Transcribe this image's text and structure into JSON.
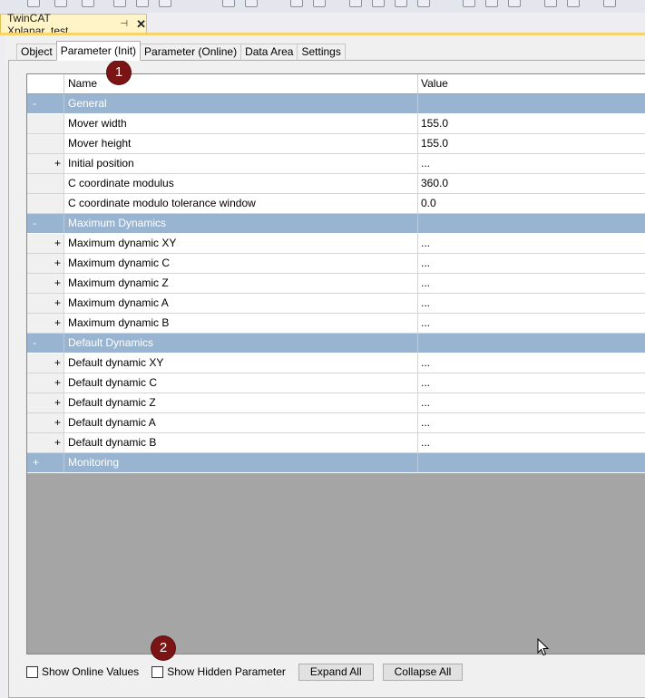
{
  "document_tab": {
    "title": "TwinCAT Xplanar_test",
    "pin_glyph": "⊣",
    "close_glyph": "✕"
  },
  "tabs": [
    {
      "label": "Object",
      "active": false
    },
    {
      "label": "Parameter (Init)",
      "active": true
    },
    {
      "label": "Parameter (Online)",
      "active": false
    },
    {
      "label": "Data Area",
      "active": false
    },
    {
      "label": "Settings",
      "active": false
    }
  ],
  "grid": {
    "columns": {
      "name": "Name",
      "value": "Value"
    },
    "rows": [
      {
        "type": "group",
        "toggle": "-",
        "name": "General",
        "value": ""
      },
      {
        "type": "item",
        "toggle": "",
        "name": "Mover width",
        "value": "155.0"
      },
      {
        "type": "item",
        "toggle": "",
        "name": "Mover height",
        "value": "155.0"
      },
      {
        "type": "item",
        "toggle": "+",
        "name": "Initial position",
        "value": "..."
      },
      {
        "type": "item",
        "toggle": "",
        "name": "C coordinate modulus",
        "value": "360.0"
      },
      {
        "type": "item",
        "toggle": "",
        "name": "C coordinate modulo tolerance window",
        "value": "0.0"
      },
      {
        "type": "group",
        "toggle": "-",
        "name": "Maximum Dynamics",
        "value": ""
      },
      {
        "type": "item",
        "toggle": "+",
        "name": "Maximum dynamic XY",
        "value": "..."
      },
      {
        "type": "item",
        "toggle": "+",
        "name": "Maximum dynamic C",
        "value": "..."
      },
      {
        "type": "item",
        "toggle": "+",
        "name": "Maximum dynamic Z",
        "value": "..."
      },
      {
        "type": "item",
        "toggle": "+",
        "name": "Maximum dynamic A",
        "value": "..."
      },
      {
        "type": "item",
        "toggle": "+",
        "name": "Maximum dynamic B",
        "value": "..."
      },
      {
        "type": "group",
        "toggle": "-",
        "name": "Default Dynamics",
        "value": ""
      },
      {
        "type": "item",
        "toggle": "+",
        "name": "Default dynamic XY",
        "value": "..."
      },
      {
        "type": "item",
        "toggle": "+",
        "name": "Default dynamic C",
        "value": "..."
      },
      {
        "type": "item",
        "toggle": "+",
        "name": "Default dynamic Z",
        "value": "..."
      },
      {
        "type": "item",
        "toggle": "+",
        "name": "Default dynamic A",
        "value": "..."
      },
      {
        "type": "item",
        "toggle": "+",
        "name": "Default dynamic B",
        "value": "..."
      },
      {
        "type": "group",
        "toggle": "+",
        "name": "Monitoring",
        "value": ""
      }
    ]
  },
  "bottom": {
    "show_online_values": {
      "label": "Show Online Values",
      "checked": false
    },
    "show_hidden_parameter": {
      "label": "Show Hidden Parameter",
      "checked": false
    },
    "expand_all": "Expand All",
    "collapse_all": "Collapse All"
  },
  "markers": {
    "one": "1",
    "two": "2"
  },
  "colors": {
    "group_row": "#99b4d1",
    "doc_tab": "#fff4c8",
    "grid_empty": "#a5a5a5",
    "marker": "#7b1414"
  }
}
